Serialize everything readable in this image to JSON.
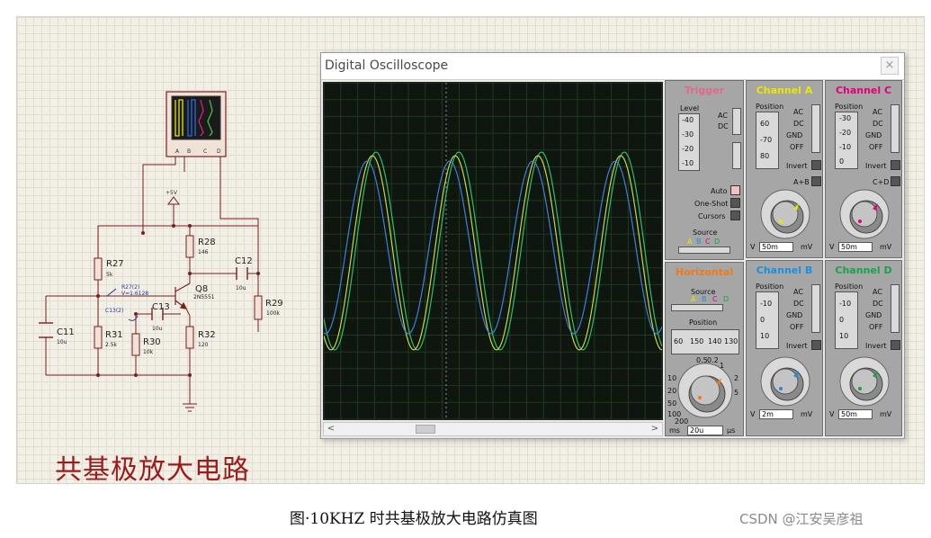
{
  "schematic": {
    "title": "共基极放大电路",
    "components": {
      "r27": {
        "name": "R27",
        "value": "5k"
      },
      "r28": {
        "name": "R28",
        "value": "146"
      },
      "r29": {
        "name": "R29",
        "value": "100k"
      },
      "r30": {
        "name": "R30",
        "value": "10k"
      },
      "r31": {
        "name": "R31",
        "value": "2.5k"
      },
      "r32": {
        "name": "R32",
        "value": "120"
      },
      "c11": {
        "name": "C11",
        "value": "10u"
      },
      "c12": {
        "name": "C12",
        "value": "10u"
      },
      "c13": {
        "name": "C13",
        "value": "10u"
      },
      "q8": {
        "name": "Q8",
        "value": "2N5551"
      },
      "vcc": "+5V",
      "probe_r27": "R27(2)",
      "probe_r27_value": "V=1.6128",
      "probe_c13": "C13(2)",
      "scope_pins": [
        "A",
        "B",
        "C",
        "D"
      ]
    }
  },
  "oscilloscope": {
    "title": "Digital Oscilloscope",
    "close_label": "×",
    "trigger": {
      "heading": "Trigger",
      "level_label": "Level",
      "level_ticks": [
        "-40",
        "-30",
        "-20",
        "-10"
      ],
      "ac": "AC",
      "dc": "DC",
      "auto": "Auto",
      "one_shot": "One-Shot",
      "cursors": "Cursors",
      "source_label": "Source",
      "sources": [
        "A",
        "B",
        "C",
        "D"
      ]
    },
    "horizontal": {
      "heading": "Horizontal",
      "source_label": "Source",
      "sources": [
        "A",
        "B",
        "C",
        "D"
      ],
      "position_label": "Position",
      "position_ticks": [
        "60",
        "150",
        "140",
        "130"
      ],
      "dial_ticks": [
        "0.5",
        "0.2",
        "1",
        "2",
        "5",
        "10",
        "20",
        "50",
        "100",
        "200"
      ],
      "unit_left": "ms",
      "value": "20u",
      "unit_right": "μs"
    },
    "channels": [
      {
        "id": "A",
        "heading": "Channel A",
        "color": "#e8e800",
        "position_label": "Position",
        "position_ticks": [
          "60",
          "-70",
          "80"
        ],
        "ac": "AC",
        "dc": "DC",
        "gnd": "GND",
        "off": "OFF",
        "invert": "Invert",
        "combine": "A+B",
        "unit_left": "V",
        "value": "50m",
        "unit_right": "mV",
        "dial_ticks": [
          "0.5",
          "0.2",
          "0.1",
          "1",
          "2",
          "5",
          "10",
          "20",
          "50",
          "2",
          "5",
          "10"
        ]
      },
      {
        "id": "C",
        "heading": "Channel C",
        "color": "#e0007a",
        "position_label": "Position",
        "position_ticks": [
          "-30",
          "-20",
          "-10",
          "0"
        ],
        "ac": "AC",
        "dc": "DC",
        "gnd": "GND",
        "off": "OFF",
        "invert": "Invert",
        "combine": "C+D",
        "unit_left": "V",
        "value": "50m",
        "unit_right": "mV",
        "dial_ticks": [
          "0.5",
          "0.2",
          "0.1",
          "1",
          "2",
          "5",
          "10",
          "20",
          "50",
          "2",
          "5",
          "10"
        ]
      },
      {
        "id": "B",
        "heading": "Channel B",
        "color": "#1a8fe0",
        "position_label": "Position",
        "position_ticks": [
          "-10",
          "0",
          "10"
        ],
        "ac": "AC",
        "dc": "DC",
        "gnd": "GND",
        "off": "OFF",
        "invert": "Invert",
        "unit_left": "V",
        "value": "2m",
        "unit_right": "mV",
        "dial_ticks": [
          "0.5",
          "0.2",
          "0.1",
          "1",
          "2",
          "5",
          "10",
          "20",
          "50",
          "2",
          "5",
          "10"
        ]
      },
      {
        "id": "D",
        "heading": "Channel D",
        "color": "#16a34a",
        "position_label": "Position",
        "position_ticks": [
          "-10",
          "0",
          "10"
        ],
        "ac": "AC",
        "dc": "DC",
        "gnd": "GND",
        "off": "OFF",
        "invert": "Invert",
        "unit_left": "V",
        "value": "50m",
        "unit_right": "mV",
        "dial_ticks": [
          "0.5",
          "0.2",
          "0.1",
          "1",
          "2",
          "5",
          "10",
          "20",
          "50",
          "2",
          "5",
          "10"
        ]
      }
    ],
    "trace_colors": {
      "channel_a": "#c9d93a",
      "channel_b": "#3f7fd6",
      "channel_d": "#2fbf6a"
    }
  },
  "figure_caption": "图·10KHZ 时共基极放大电路仿真图",
  "watermark": "CSDN @江安吴彦祖"
}
